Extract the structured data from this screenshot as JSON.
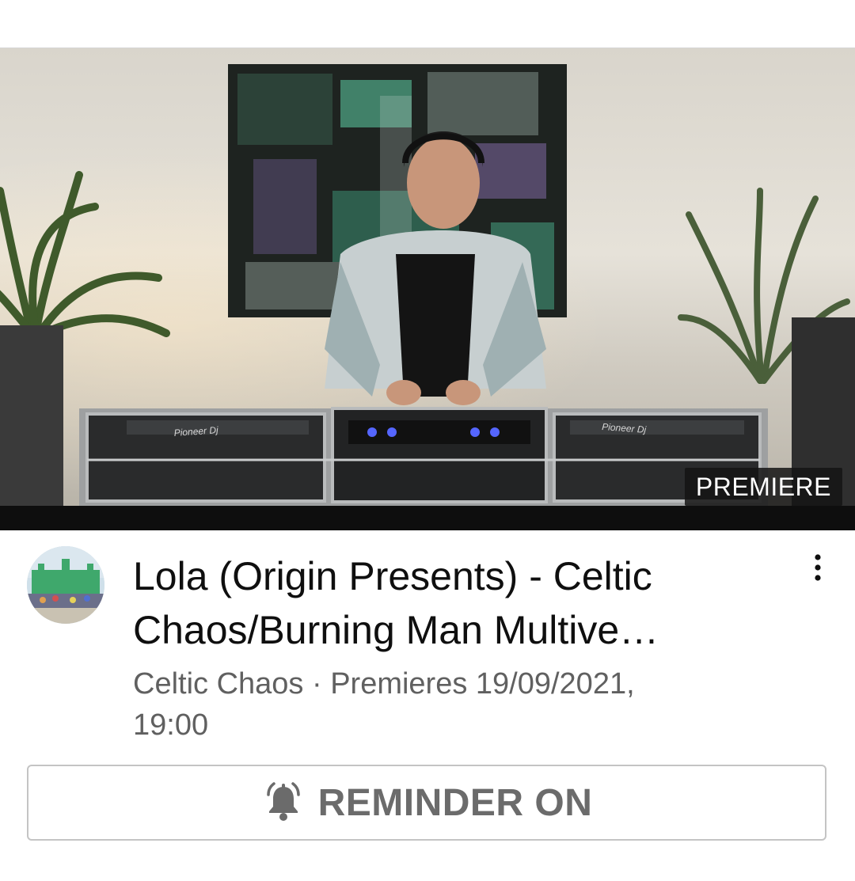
{
  "video": {
    "badge": "PREMIERE",
    "deck_label_left": "Pioneer Dj",
    "deck_label_right": "Pioneer Dj"
  },
  "details": {
    "title_line_1": "Lola (Origin Presents) - Celtic",
    "title_line_2": "Chaos/Burning Man Multive…",
    "meta_line_1": "Celtic Chaos · Premieres 19/09/2021,",
    "meta_line_2": "19:00",
    "menu_icon": "more-vertical-icon",
    "avatar": "channel-avatar"
  },
  "reminder": {
    "label": "REMINDER ON",
    "icon": "bell-ringing-icon"
  },
  "colors": {
    "title": "#0f0f0f",
    "meta": "#606060",
    "button_border": "#c4c4c4",
    "button_text": "#6b6b6b",
    "badge_bg": "#141414"
  }
}
